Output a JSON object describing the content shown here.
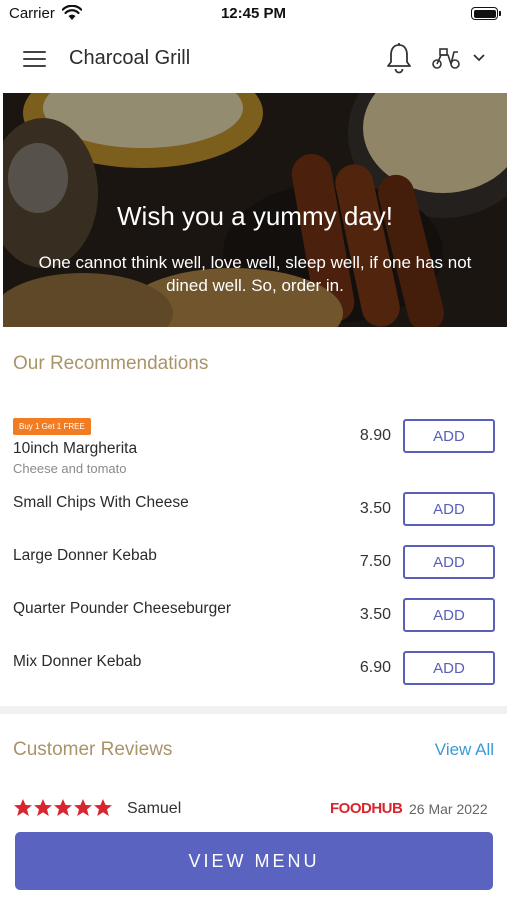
{
  "status_bar": {
    "carrier": "Carrier",
    "time": "12:45 PM"
  },
  "header": {
    "title": "Charcoal Grill"
  },
  "hero": {
    "title": "Wish you a yummy day!",
    "subtitle": "One cannot think well, love well, sleep well, if one has not dined well. So, order in."
  },
  "recommendations": {
    "title": "Our Recommendations",
    "items": [
      {
        "promo": "Buy 1 Get 1 FREE",
        "name": "10inch Margherita",
        "description": "Cheese and tomato",
        "price": "8.90",
        "button": "ADD"
      },
      {
        "name": "Small Chips With Cheese",
        "price": "3.50",
        "button": "ADD"
      },
      {
        "name": "Large Donner Kebab",
        "price": "7.50",
        "button": "ADD"
      },
      {
        "name": "Quarter Pounder Cheeseburger",
        "price": "3.50",
        "button": "ADD"
      },
      {
        "name": "Mix Donner Kebab",
        "price": "6.90",
        "button": "ADD"
      }
    ]
  },
  "reviews": {
    "title": "Customer Reviews",
    "view_all": "View All",
    "items": [
      {
        "rating": 5,
        "reviewer": "Samuel",
        "source": "FOODHUB",
        "date": "26 Mar 2022"
      }
    ]
  },
  "footer": {
    "button": "VIEW MENU"
  },
  "colors": {
    "accent": "#5a63bf",
    "section_title": "#a9946a",
    "link": "#3a9ad6",
    "promo": "#f27c22",
    "stars": "#d7262f"
  }
}
